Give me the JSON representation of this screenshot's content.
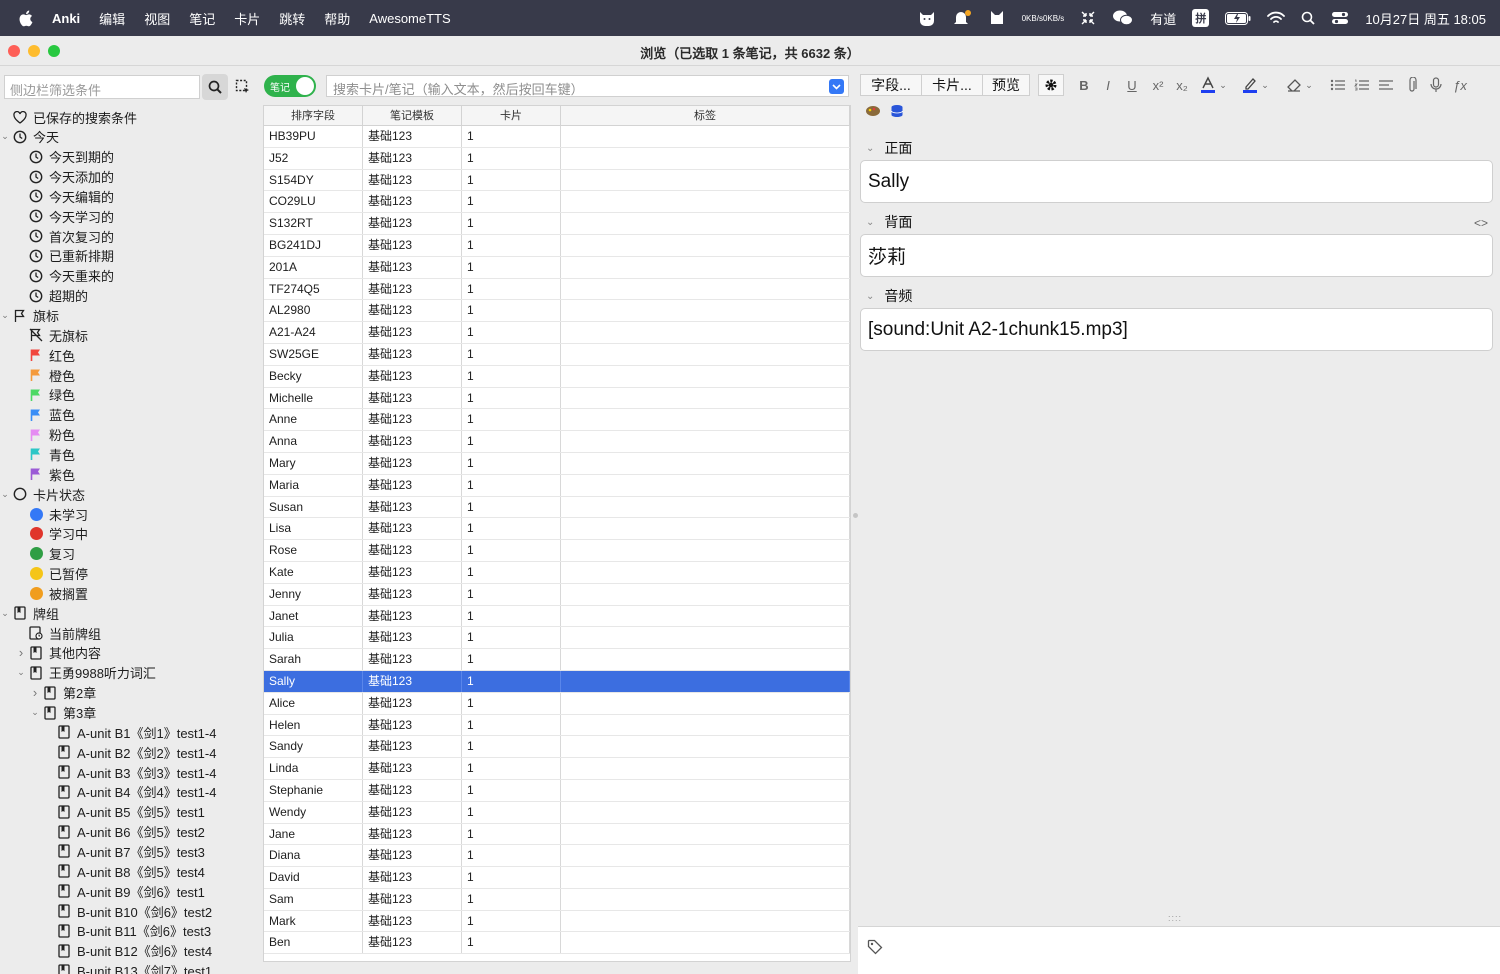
{
  "menubar": {
    "items": [
      "Anki",
      "编辑",
      "视图",
      "笔记",
      "卡片",
      "跳转",
      "帮助",
      "AwesomeTTS"
    ],
    "net_up": "0KB/s",
    "net_down": "0KB/s",
    "youdao": "有道",
    "ime": "拼",
    "clock": "10月27日 周五 18:05"
  },
  "window": {
    "title": "浏览（已选取 1 条笔记，共 6632 条）"
  },
  "sidebar": {
    "search_placeholder": "侧边栏筛选条件",
    "tree": [
      {
        "label": "已保存的搜索条件",
        "icon": "heart-icon",
        "depth": 1,
        "expand": "none"
      },
      {
        "label": "今天",
        "icon": "clock-icon",
        "depth": 1,
        "expand": "open"
      },
      {
        "label": "今天到期的",
        "icon": "clock-icon",
        "depth": 2,
        "expand": "none"
      },
      {
        "label": "今天添加的",
        "icon": "clock-icon",
        "depth": 2,
        "expand": "none"
      },
      {
        "label": "今天编辑的",
        "icon": "clock-icon",
        "depth": 2,
        "expand": "none"
      },
      {
        "label": "今天学习的",
        "icon": "clock-icon",
        "depth": 2,
        "expand": "none"
      },
      {
        "label": "首次复习的",
        "icon": "clock-icon",
        "depth": 2,
        "expand": "none"
      },
      {
        "label": "已重新排期",
        "icon": "clock-icon",
        "depth": 2,
        "expand": "none"
      },
      {
        "label": "今天重来的",
        "icon": "clock-icon",
        "depth": 2,
        "expand": "none"
      },
      {
        "label": "超期的",
        "icon": "clock-icon",
        "depth": 2,
        "expand": "none"
      },
      {
        "label": "旗标",
        "icon": "flag-outline-icon",
        "depth": 1,
        "expand": "open"
      },
      {
        "label": "无旗标",
        "icon": "no-flag-icon",
        "depth": 2,
        "expand": "none"
      },
      {
        "label": "红色",
        "icon": "flag-icon",
        "color": "#f1453d",
        "depth": 2,
        "expand": "none"
      },
      {
        "label": "橙色",
        "icon": "flag-icon",
        "color": "#f49a3c",
        "depth": 2,
        "expand": "none"
      },
      {
        "label": "绿色",
        "icon": "flag-icon",
        "color": "#4cd964",
        "depth": 2,
        "expand": "none"
      },
      {
        "label": "蓝色",
        "icon": "flag-icon",
        "color": "#3a8ef6",
        "depth": 2,
        "expand": "none"
      },
      {
        "label": "粉色",
        "icon": "flag-icon",
        "color": "#e58cf2",
        "depth": 2,
        "expand": "none"
      },
      {
        "label": "青色",
        "icon": "flag-icon",
        "color": "#2cc6c6",
        "depth": 2,
        "expand": "none"
      },
      {
        "label": "紫色",
        "icon": "flag-icon",
        "color": "#9b5bd6",
        "depth": 2,
        "expand": "none"
      },
      {
        "label": "卡片状态",
        "icon": "circle-outline-icon",
        "depth": 1,
        "expand": "open"
      },
      {
        "label": "未学习",
        "icon": "dot-icon",
        "color": "#3478f6",
        "depth": 2,
        "expand": "none"
      },
      {
        "label": "学习中",
        "icon": "dot-icon",
        "color": "#e0352b",
        "depth": 2,
        "expand": "none"
      },
      {
        "label": "复习",
        "icon": "dot-icon",
        "color": "#2f9e44",
        "depth": 2,
        "expand": "none"
      },
      {
        "label": "已暂停",
        "icon": "dot-icon",
        "color": "#f5c518",
        "depth": 2,
        "expand": "none"
      },
      {
        "label": "被搁置",
        "icon": "dot-icon",
        "color": "#f09d1e",
        "depth": 2,
        "expand": "none"
      },
      {
        "label": "牌组",
        "icon": "deck-icon",
        "depth": 1,
        "expand": "open"
      },
      {
        "label": "当前牌组",
        "icon": "current-deck-icon",
        "depth": 2,
        "expand": "none"
      },
      {
        "label": "其他内容",
        "icon": "deck-icon",
        "depth": 2,
        "expand": "closed"
      },
      {
        "label": "王勇9988听力词汇",
        "icon": "deck-icon",
        "depth": 2,
        "expand": "open"
      },
      {
        "label": "第2章",
        "icon": "deck-icon",
        "depth": 3,
        "expand": "closed"
      },
      {
        "label": "第3章",
        "icon": "deck-icon",
        "depth": 3,
        "expand": "open"
      },
      {
        "label": "A-unit B1《剑1》test1-4",
        "icon": "deck-icon",
        "depth": 4,
        "expand": "none"
      },
      {
        "label": "A-unit B2《剑2》test1-4",
        "icon": "deck-icon",
        "depth": 4,
        "expand": "none"
      },
      {
        "label": "A-unit B3《剑3》test1-4",
        "icon": "deck-icon",
        "depth": 4,
        "expand": "none"
      },
      {
        "label": "A-unit B4《剑4》test1-4",
        "icon": "deck-icon",
        "depth": 4,
        "expand": "none"
      },
      {
        "label": "A-unit B5《剑5》test1",
        "icon": "deck-icon",
        "depth": 4,
        "expand": "none"
      },
      {
        "label": "A-unit B6《剑5》test2",
        "icon": "deck-icon",
        "depth": 4,
        "expand": "none"
      },
      {
        "label": "A-unit B7《剑5》test3",
        "icon": "deck-icon",
        "depth": 4,
        "expand": "none"
      },
      {
        "label": "A-unit B8《剑5》test4",
        "icon": "deck-icon",
        "depth": 4,
        "expand": "none"
      },
      {
        "label": "A-unit B9《剑6》test1",
        "icon": "deck-icon",
        "depth": 4,
        "expand": "none"
      },
      {
        "label": "B-unit B10《剑6》test2",
        "icon": "deck-icon",
        "depth": 4,
        "expand": "none"
      },
      {
        "label": "B-unit B11《剑6》test3",
        "icon": "deck-icon",
        "depth": 4,
        "expand": "none"
      },
      {
        "label": "B-unit B12《剑6》test4",
        "icon": "deck-icon",
        "depth": 4,
        "expand": "none"
      },
      {
        "label": "B-unit B13《剑7》test1",
        "icon": "deck-icon",
        "depth": 4,
        "expand": "none"
      }
    ]
  },
  "browser": {
    "mode_toggle_label": "笔记",
    "search_placeholder": "搜索卡片/笔记（输入文本，然后按回车键）",
    "columns": [
      "排序字段",
      "笔记模板",
      "卡片",
      "标签"
    ],
    "selected_index": 25,
    "rows": [
      {
        "sort_field": "HB39PU",
        "note_type": "基础123",
        "cards": "1",
        "tags": ""
      },
      {
        "sort_field": "J52",
        "note_type": "基础123",
        "cards": "1",
        "tags": ""
      },
      {
        "sort_field": "S154DY",
        "note_type": "基础123",
        "cards": "1",
        "tags": ""
      },
      {
        "sort_field": "CO29LU",
        "note_type": "基础123",
        "cards": "1",
        "tags": ""
      },
      {
        "sort_field": "S132RT",
        "note_type": "基础123",
        "cards": "1",
        "tags": ""
      },
      {
        "sort_field": "BG241DJ",
        "note_type": "基础123",
        "cards": "1",
        "tags": ""
      },
      {
        "sort_field": "201A",
        "note_type": "基础123",
        "cards": "1",
        "tags": ""
      },
      {
        "sort_field": "TF274Q5",
        "note_type": "基础123",
        "cards": "1",
        "tags": ""
      },
      {
        "sort_field": "AL2980",
        "note_type": "基础123",
        "cards": "1",
        "tags": ""
      },
      {
        "sort_field": "A21-A24",
        "note_type": "基础123",
        "cards": "1",
        "tags": ""
      },
      {
        "sort_field": "SW25GE",
        "note_type": "基础123",
        "cards": "1",
        "tags": ""
      },
      {
        "sort_field": "Becky",
        "note_type": "基础123",
        "cards": "1",
        "tags": ""
      },
      {
        "sort_field": "Michelle",
        "note_type": "基础123",
        "cards": "1",
        "tags": ""
      },
      {
        "sort_field": "Anne",
        "note_type": "基础123",
        "cards": "1",
        "tags": ""
      },
      {
        "sort_field": "Anna",
        "note_type": "基础123",
        "cards": "1",
        "tags": ""
      },
      {
        "sort_field": "Mary",
        "note_type": "基础123",
        "cards": "1",
        "tags": ""
      },
      {
        "sort_field": "Maria",
        "note_type": "基础123",
        "cards": "1",
        "tags": ""
      },
      {
        "sort_field": "Susan",
        "note_type": "基础123",
        "cards": "1",
        "tags": ""
      },
      {
        "sort_field": "Lisa",
        "note_type": "基础123",
        "cards": "1",
        "tags": ""
      },
      {
        "sort_field": "Rose",
        "note_type": "基础123",
        "cards": "1",
        "tags": ""
      },
      {
        "sort_field": "Kate",
        "note_type": "基础123",
        "cards": "1",
        "tags": ""
      },
      {
        "sort_field": "Jenny",
        "note_type": "基础123",
        "cards": "1",
        "tags": ""
      },
      {
        "sort_field": "Janet",
        "note_type": "基础123",
        "cards": "1",
        "tags": ""
      },
      {
        "sort_field": "Julia",
        "note_type": "基础123",
        "cards": "1",
        "tags": ""
      },
      {
        "sort_field": "Sarah",
        "note_type": "基础123",
        "cards": "1",
        "tags": ""
      },
      {
        "sort_field": "Sally",
        "note_type": "基础123",
        "cards": "1",
        "tags": ""
      },
      {
        "sort_field": "Alice",
        "note_type": "基础123",
        "cards": "1",
        "tags": ""
      },
      {
        "sort_field": "Helen",
        "note_type": "基础123",
        "cards": "1",
        "tags": ""
      },
      {
        "sort_field": "Sandy",
        "note_type": "基础123",
        "cards": "1",
        "tags": ""
      },
      {
        "sort_field": "Linda",
        "note_type": "基础123",
        "cards": "1",
        "tags": ""
      },
      {
        "sort_field": "Stephanie",
        "note_type": "基础123",
        "cards": "1",
        "tags": ""
      },
      {
        "sort_field": "Wendy",
        "note_type": "基础123",
        "cards": "1",
        "tags": ""
      },
      {
        "sort_field": "Jane",
        "note_type": "基础123",
        "cards": "1",
        "tags": ""
      },
      {
        "sort_field": "Diana",
        "note_type": "基础123",
        "cards": "1",
        "tags": ""
      },
      {
        "sort_field": "David",
        "note_type": "基础123",
        "cards": "1",
        "tags": ""
      },
      {
        "sort_field": "Sam",
        "note_type": "基础123",
        "cards": "1",
        "tags": ""
      },
      {
        "sort_field": "Mark",
        "note_type": "基础123",
        "cards": "1",
        "tags": ""
      },
      {
        "sort_field": "Ben",
        "note_type": "基础123",
        "cards": "1",
        "tags": ""
      }
    ]
  },
  "editor": {
    "toolbar": {
      "fields_button": "字段...",
      "cards_button": "卡片...",
      "preview_button": "预览"
    },
    "fields": [
      {
        "label": "正面",
        "value": "Sally"
      },
      {
        "label": "背面",
        "value": "莎莉"
      },
      {
        "label": "音频",
        "value": "[sound:Unit A2-1chunk15.mp3]"
      }
    ]
  },
  "colors": {
    "selection": "#3c6ee0",
    "toggle_on": "#2fb24c",
    "accent": "#3478f6"
  }
}
